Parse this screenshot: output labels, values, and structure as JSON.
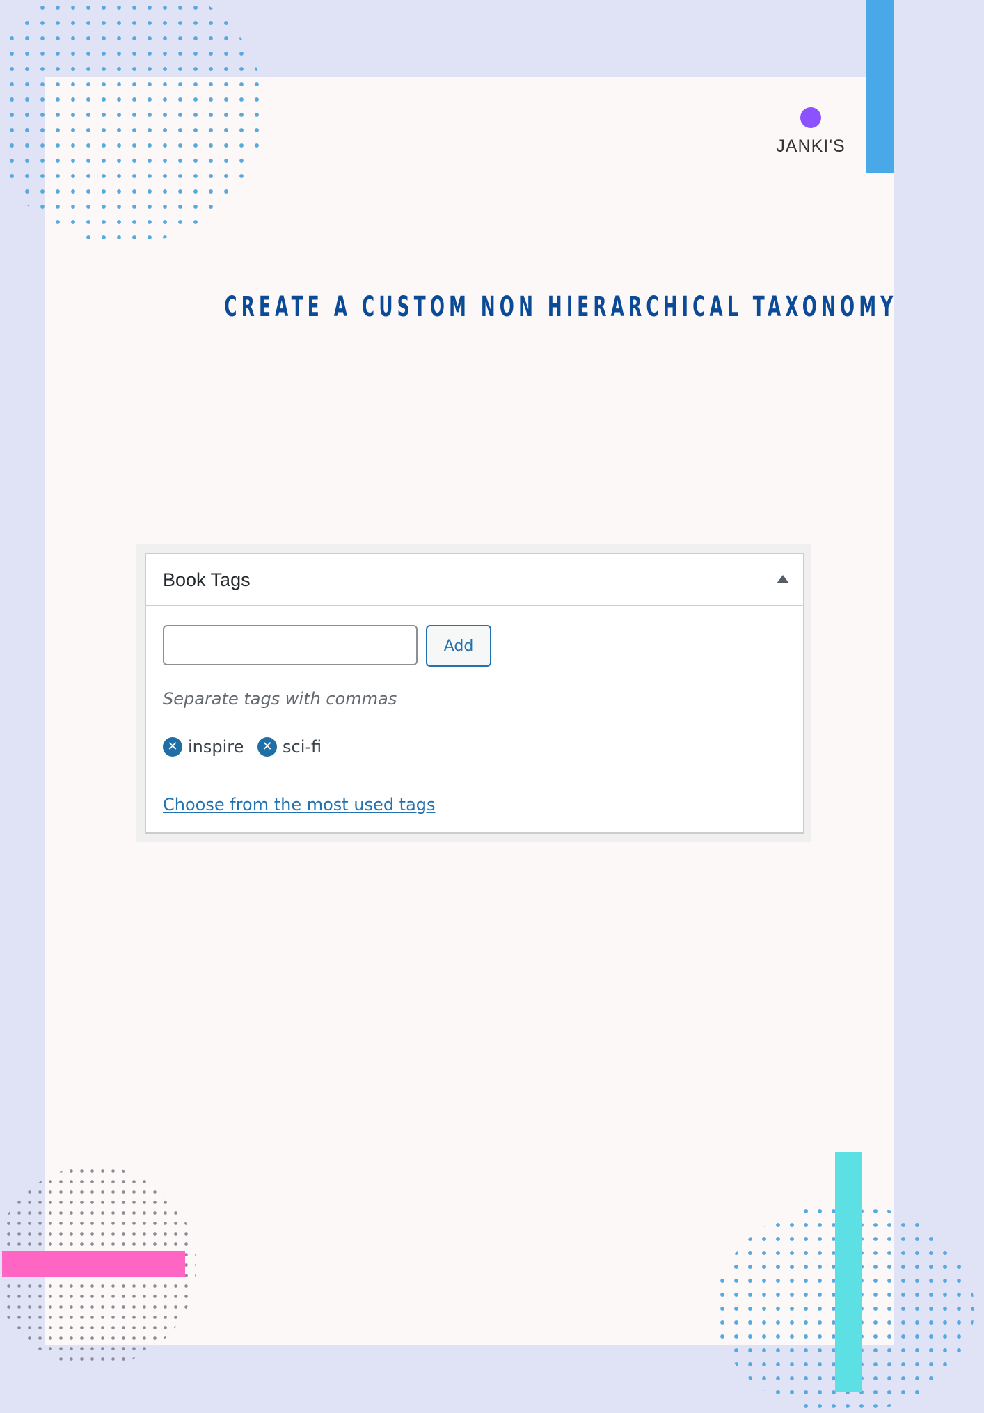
{
  "brand": {
    "name": "JANKI'S"
  },
  "heading": {
    "title": "CREATE A CUSTOM NON HIERARCHICAL TAXONOMY"
  },
  "metabox": {
    "title": "Book Tags",
    "input_value": "",
    "add_label": "Add",
    "hint": "Separate tags with commas",
    "tags": [
      {
        "remove_icon": "✕",
        "label": "inspire"
      },
      {
        "remove_icon": "✕",
        "label": "sci-fi"
      }
    ],
    "most_used_link": "Choose from the most used tags"
  },
  "colors": {
    "background": "#dfe3f5",
    "page": "#fdf8f8",
    "title": "#0b4a96",
    "brand_dot": "#8c52ff",
    "accent_blue": "#49a9e8",
    "accent_teal": "#5ce0e3",
    "accent_pink": "#ff66c4",
    "wp_link": "#2271b1"
  }
}
